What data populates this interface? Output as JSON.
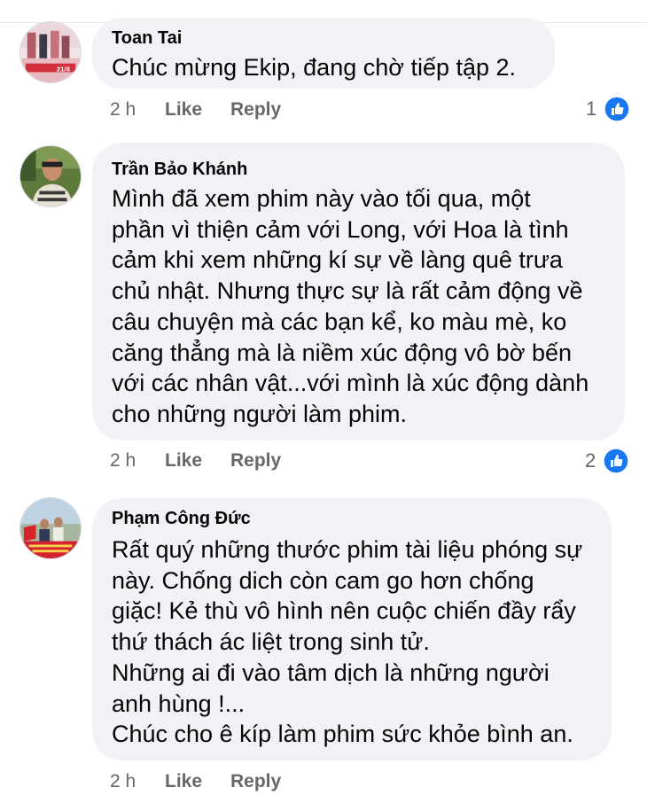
{
  "comments": [
    {
      "author": "Toan Tai",
      "text": "Chúc mừng Ekip, đang chờ tiếp tập 2.",
      "time": "2 h",
      "like_label": "Like",
      "reply_label": "Reply",
      "reaction_count": "1",
      "avatar_badge_text": "21/8"
    },
    {
      "author": "Trần Bảo Khánh",
      "text": "Mình đã xem phim này vào tối qua, một\nphần vì thiện cảm với Long, với Hoa là tình\ncảm khi xem những kí sự về làng quê trưa\nchủ nhật. Nhưng thực sự là rất cảm động về\ncâu chuyện mà các bạn kể, ko màu mè, ko\ncăng thẳng mà là niềm xúc động vô bờ bến\nvới các nhân vật...với mình là xúc động dành\ncho những người làm phim.",
      "time": "2 h",
      "like_label": "Like",
      "reply_label": "Reply",
      "reaction_count": "2"
    },
    {
      "author": "Phạm Công Đức",
      "text": "Rất quý những thước phim tài liệu phóng sự\nnày. Chống dich còn cam go hơn chống\ngiặc!  Kẻ thù vô hình nên cuộc chiến đầy rẩy\nthứ thách  ác liệt trong sinh tử.\nNhững ai đi vào tâm dịch là những người\nanh hùng !...\nChúc cho ê kíp làm phim sức khỏe bình an.",
      "time": "2 h",
      "like_label": "Like",
      "reply_label": "Reply"
    }
  ],
  "colors": {
    "bubble": "#f0f2f5",
    "meta_text": "#65676b",
    "like_blue": "#1877f2"
  },
  "icons": {
    "reaction": "thumbs-up-icon"
  }
}
